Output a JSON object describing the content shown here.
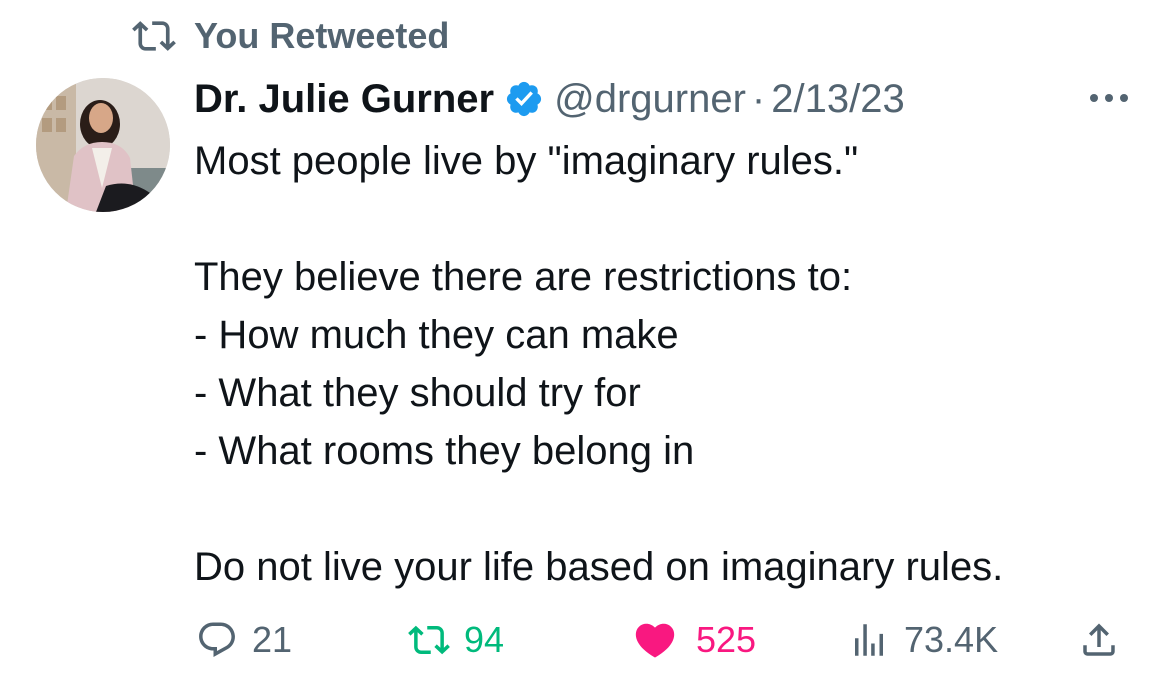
{
  "social_context": {
    "text": "You Retweeted",
    "icon": "retweet-icon"
  },
  "author": {
    "display_name": "Dr. Julie Gurner",
    "handle": "@drgurner",
    "separator": "·",
    "date": "2/13/23",
    "verified": true
  },
  "body": {
    "line1": "Most people live by \"imaginary rules.\"",
    "line2": "They believe there are restrictions to:",
    "line3": "- How much they can make",
    "line4": "- What they should try for",
    "line5": "- What rooms they belong in",
    "line6": "Do not live your life based on imaginary rules."
  },
  "stats": {
    "replies": "21",
    "retweets": "94",
    "likes": "525",
    "views": "73.4K"
  },
  "colors": {
    "text_primary": "#0f1419",
    "text_secondary": "#536471",
    "verified_blue": "#1d9bf0",
    "retweet_green": "#00ba7c",
    "like_pink": "#f91880"
  }
}
